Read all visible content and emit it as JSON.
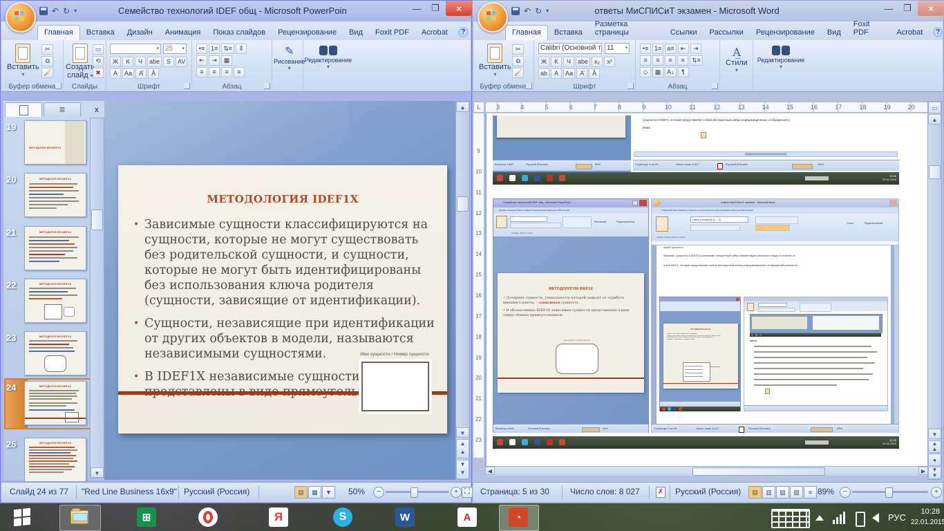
{
  "ppt": {
    "window_title": "Семейство технологий IDEF общ - Microsoft PowerPoint",
    "tabs": [
      "Главная",
      "Вставка",
      "Дизайн",
      "Анимация",
      "Показ слайдов",
      "Рецензирование",
      "Вид",
      "Foxit PDF",
      "Acrobat"
    ],
    "ribbon": {
      "paste": "Вставить",
      "group_clipboard": "Буфер обмена",
      "new_slide_1": "Создать",
      "new_slide_2": "слайд",
      "group_slides": "Слайды",
      "font_size": "25",
      "font_glyphs": [
        "Ж",
        "К",
        "Ч",
        "abe",
        "S",
        "AV"
      ],
      "font_glyphs2": [
        "А",
        "Аа",
        "А̂",
        "А̌"
      ],
      "para_glyphs": [
        "•≡",
        "1≡",
        "⇅≡",
        "⫴"
      ],
      "para_glyphs2": [
        "⇤",
        "⇥",
        "▦"
      ],
      "para_glyphs3": [
        "≡",
        "≡",
        "≡",
        "≡"
      ],
      "group_font": "Шрифт",
      "group_para": "Абзац",
      "drawing": "Рисование",
      "editing": "Редактирование"
    },
    "pane": {
      "numbers": [
        "19",
        "20",
        "21",
        "22",
        "23",
        "24",
        "25"
      ]
    },
    "slide": {
      "title": "МЕТОДОЛОГИЯ IDEF1X",
      "bullets": [
        "Зависимые сущности классифицируются на сущности, которые не могут существовать без родительской сущности, и сущности, которые не могут быть идентифицированы без использования ключа родителя (сущности, зависящие от идентификации).",
        "Сущности, независящие при идентификации от других объектов в модели, называются независимыми сущностями.",
        "В IDEF1X независимые сущности представлены в виде прямоугольников"
      ],
      "entity_caption": "Имя сущности / Номер сущности"
    },
    "status": {
      "slide": "Слайд 24 из 77",
      "theme": "\"Red Line Business 16x9\"",
      "lang": "Русский (Россия)",
      "zoom": "50%"
    }
  },
  "word": {
    "window_title": "ответы МиСПИСиТ экзамен - Microsoft Word",
    "tabs": [
      "Главная",
      "Вставка",
      "Разметка страницы",
      "Ссылки",
      "Рассылки",
      "Рецензирование",
      "Вид",
      "Foxit PDF",
      "Acrobat"
    ],
    "ribbon": {
      "paste": "Вставить",
      "group_clipboard": "Буфер обмена",
      "font_name": "Calibri (Основной те",
      "font_size": "11",
      "font_glyphs": [
        "Ж",
        "К",
        "Ч",
        "abe",
        "x₂",
        "x²"
      ],
      "font_glyphs2": [
        "ab",
        "А",
        "Аа",
        "А̂",
        "А̌"
      ],
      "para_glyphs": [
        "•≡",
        "1≡",
        "а≡",
        "⇤",
        "⇥"
      ],
      "para_glyphs2": [
        "≡",
        "≡",
        "≡",
        "≡",
        "⇅≡"
      ],
      "para_glyphs3": [
        "◇",
        "▦",
        "А↓",
        "¶"
      ],
      "group_font": "Шрифт",
      "group_para": "Абзац",
      "styles": "Стили",
      "editing": "Редактирование"
    },
    "hruler": [
      "3",
      "4",
      "5",
      "6",
      "7",
      "8",
      "9",
      "10",
      "11",
      "12",
      "13",
      "14",
      "15",
      "16",
      "17",
      "18",
      "19",
      "20"
    ],
    "vruler": [
      "9",
      "10",
      "11",
      "12",
      "13",
      "14",
      "15",
      "16",
      "17",
      "18",
      "19",
      "20",
      "21",
      "22",
      "23"
    ],
    "status": {
      "page": "Страница: 5 из 30",
      "words": "Число слов: 8 027",
      "lang": "Русский (Россия)",
      "zoom": "89%"
    },
    "doc": {
      "shot1": {
        "ppt_theme": "Business 16x9\"",
        "ppt_lang": "Русский (Россия)",
        "ppt_zoom": "50%",
        "line1": "сущности в IDEF1, которая представляет собой абстрактный набор информационных отображений р",
        "line2": "мира.",
        "w_page": "Страница: 5 из 29",
        "w_words": "Число слов: 8 027",
        "w_lang": "Русский (Россия)",
        "w_zoom": "89%",
        "time": "10:28",
        "date": "22.01.2015"
      },
      "shot2": {
        "ppt_title": "Семейство технологий IDEF общ - Microsoft PowerPoint",
        "ppt_tabs": "Дизайн   Анимация   Показ слайдов   Рецензирование   Вид   Foxit PDF   Acrobat",
        "ppt_drawing": "Рисование",
        "ppt_editing": "Редактирование",
        "ppt_groups": "Слайды          Шрифт                    Абзац",
        "slide_title": "МЕТОДОЛОГИЯ IDEF1X",
        "b1_pre": "Дочерняя сущность, уникальность которой зависит от атрибута внешнего ключа, - ",
        "b1_hl": "зависимая",
        "b1_post": " сущность.",
        "b2": "В обозначениях IDEF1X зависимые сущности представлены в виде закруглённых прямоугольников.",
        "entity_caption": "Имя сущности / Номер сущности",
        "ppt_status": {
          "theme": "Business 16x9\"",
          "lang": "Русский (Россия)",
          "zoom": "50%"
        },
        "word_title": "ответы МиСПИСиТ экзамен - Microsoft Word",
        "word_tabs": "Главная  Вставка  Разметка страницы  Ссылки  Рассылки  Рецензирование  Вид  Foxit PDF  Acrobat",
        "word_font": "Calibri (Основной те ⌄  11",
        "word_styles": "Стили",
        "word_editing": "Редактирование",
        "word_groups": "Буфер обмена         Шрифт                     Абзац",
        "line0": "ацией сущность.",
        "line1": "образом, сущность в IDEF1X описывает конкретный набор экземпляров реального мира, в отличие от",
        "line2": "сти в IDEF1, которая представляет собой абстрактный набор информационных отображений реального",
        "word_status": {
          "page": "Страница: 5 из 30",
          "words": "Число слов: 8 027",
          "lang": "Русский (Россия)",
          "zoom": "89%"
        },
        "nested": {
          "ppt_slide_title": "МЕТОДОЛОГИЯ IDEF1X",
          "ppt_bullets": [
            "Связи – это ссылки, соединения и ассоциации.",
            "Связи – это глаголы, которые показывают, как соотносятся сущности между собой.",
            "В зависимости от типа отношения связи могут иметь разную мощность.",
            "Сущность - обозначается прямоугольником."
          ],
          "word_heading": "IDEF1X"
        },
        "time": "10:28",
        "date": "22.01.2015"
      }
    }
  },
  "taskbar": {
    "tray_lang": "РУС",
    "tray_time": "10:28",
    "tray_date": "22.01.2015"
  }
}
